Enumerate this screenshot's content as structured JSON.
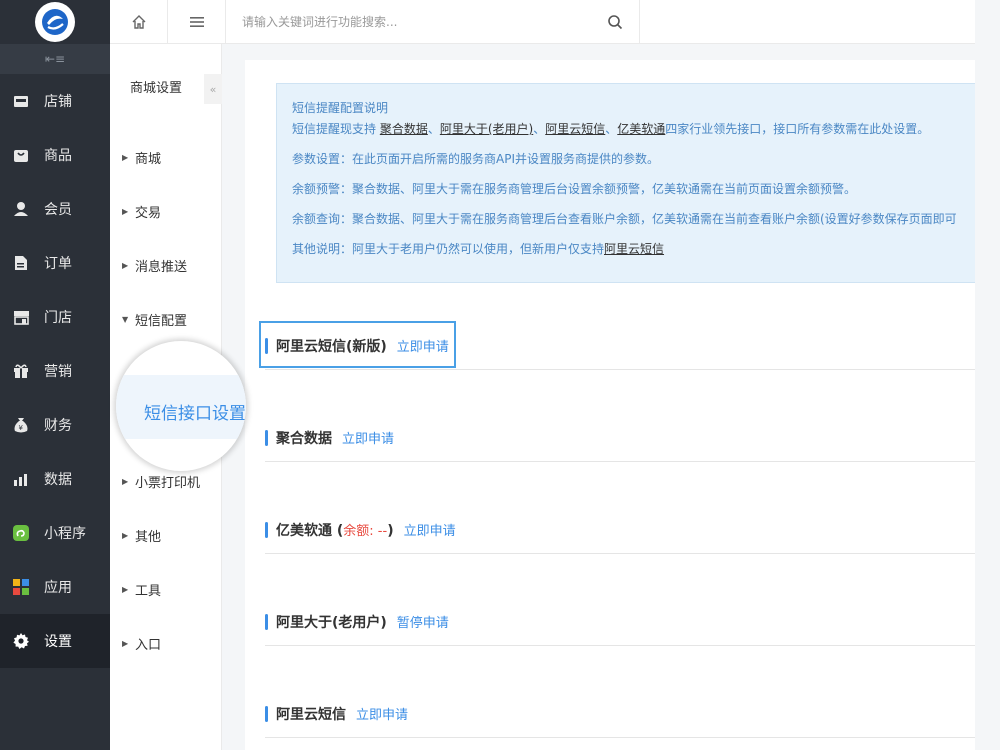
{
  "sidebar": {
    "items": [
      {
        "label": "店铺",
        "icon": "store-icon"
      },
      {
        "label": "商品",
        "icon": "goods-icon"
      },
      {
        "label": "会员",
        "icon": "member-icon"
      },
      {
        "label": "订单",
        "icon": "order-icon"
      },
      {
        "label": "门店",
        "icon": "shop-icon"
      },
      {
        "label": "营销",
        "icon": "gift-icon"
      },
      {
        "label": "财务",
        "icon": "money-bag-icon"
      },
      {
        "label": "数据",
        "icon": "chart-icon"
      },
      {
        "label": "小程序",
        "icon": "miniapp-icon"
      },
      {
        "label": "应用",
        "icon": "apps-icon"
      },
      {
        "label": "设置",
        "icon": "gear-icon",
        "active": true
      }
    ]
  },
  "header": {
    "search_placeholder": "请输入关键词进行功能搜索..."
  },
  "subnav": {
    "title": "商城设置",
    "fold": "«",
    "items": [
      {
        "label": "商城"
      },
      {
        "label": "交易"
      },
      {
        "label": "消息推送"
      },
      {
        "label": "短信配置",
        "expanded": true
      },
      {
        "label": "小票打印机"
      },
      {
        "label": "其他"
      },
      {
        "label": "工具"
      },
      {
        "label": "入口"
      }
    ],
    "magnified": "短信接口设置"
  },
  "notice": {
    "title": "短信提醒配置说明",
    "support_prefix": "短信提醒现支持 ",
    "providers": [
      "聚合数据",
      "阿里大于(老用户)",
      "阿里云短信",
      "亿美软通"
    ],
    "sep": "、",
    "support_suffix": "四家行业领先接口，接口所有参数需在此处设置。",
    "param": "参数设置：在此页面开启所需的服务商API并设置服务商提供的参数。",
    "balance_warn": "余额预警：聚合数据、阿里大于需在服务商管理后台设置余额预警，亿美软通需在当前页面设置余额预警。",
    "balance_query": "余额查询：聚合数据、阿里大于需在服务商管理后台查看账户余额，亿美软通需在当前查看账户余额(设置好参数保存页面即可",
    "other_prefix": "其他说明：阿里大于老用户仍然可以使用，但新用户仅支持",
    "other_link": "阿里云短信"
  },
  "sections": [
    {
      "name": "阿里云短信(新版)",
      "link": "立即申请"
    },
    {
      "name": "聚合数据",
      "link": "立即申请"
    },
    {
      "name": "亿美软通",
      "balance_open": " (",
      "balance": "余额: --",
      "balance_close": ")",
      "link": "立即申请"
    },
    {
      "name": "阿里大于(老用户)",
      "link": "暂停申请"
    },
    {
      "name": "阿里云短信",
      "link": "立即申请"
    }
  ],
  "colors": {
    "sidebar_bg": "#2b3038",
    "accent": "#3b8ee6",
    "notice_bg": "#e6f2fb",
    "warning_red": "#e84a3f"
  }
}
